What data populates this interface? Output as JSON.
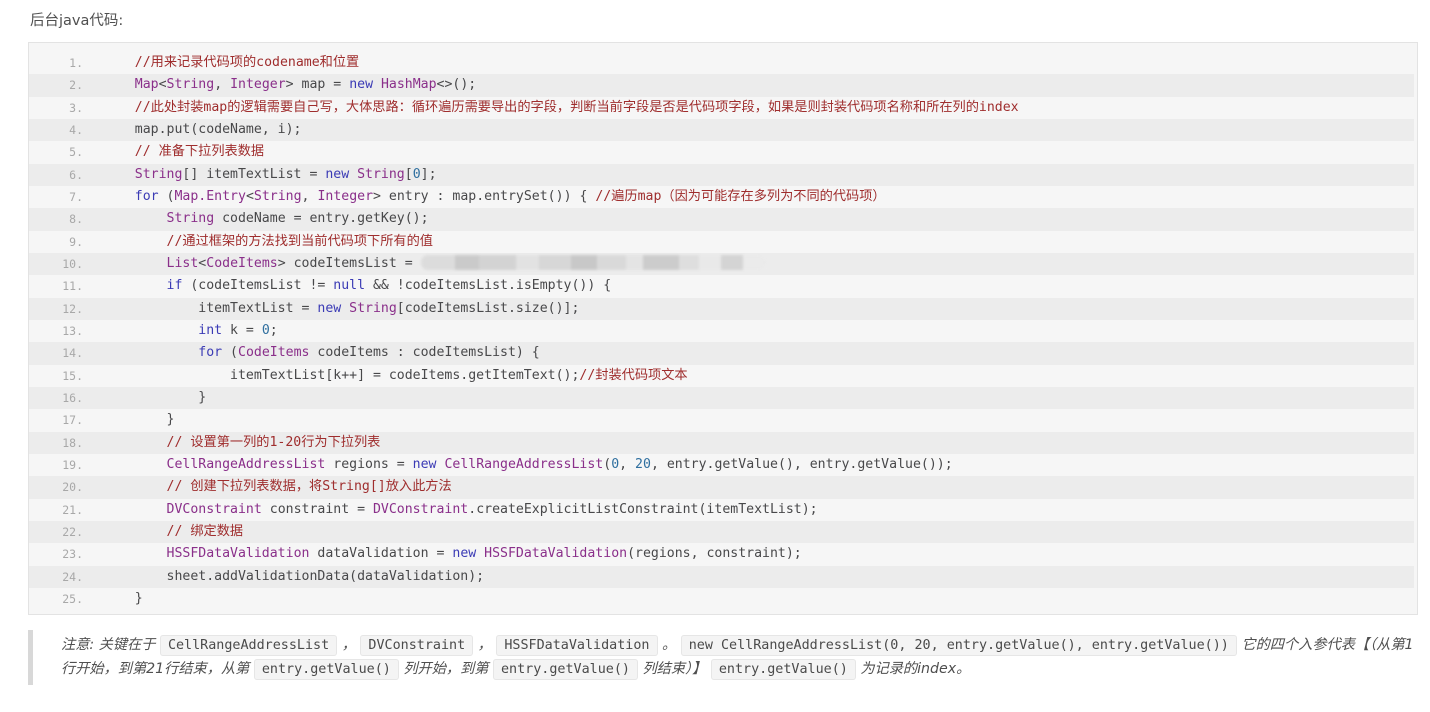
{
  "intro": {
    "text": "后台java代码:"
  },
  "code": {
    "language": "java",
    "lines": [
      {
        "n": "1.",
        "indent": 1,
        "tokens": [
          {
            "t": "cm",
            "s": "//用来记录代码项的codename和位置"
          }
        ]
      },
      {
        "n": "2.",
        "indent": 1,
        "tokens": [
          {
            "t": "ty",
            "s": "Map"
          },
          {
            "t": "pl",
            "s": "<"
          },
          {
            "t": "ty",
            "s": "String"
          },
          {
            "t": "pl",
            "s": ", "
          },
          {
            "t": "ty",
            "s": "Integer"
          },
          {
            "t": "pl",
            "s": "> map = "
          },
          {
            "t": "kw",
            "s": "new"
          },
          {
            "t": "pl",
            "s": " "
          },
          {
            "t": "ty",
            "s": "HashMap"
          },
          {
            "t": "pl",
            "s": "<>();"
          }
        ]
      },
      {
        "n": "3.",
        "indent": 1,
        "tokens": [
          {
            "t": "cm",
            "s": "//此处封装map的逻辑需要自己写，大体思路：循环遍历需要导出的字段，判断当前字段是否是代码项字段，如果是则封装代码项名称和所在列的index"
          }
        ]
      },
      {
        "n": "4.",
        "indent": 1,
        "tokens": [
          {
            "t": "pl",
            "s": "map.put(codeName, i);"
          }
        ]
      },
      {
        "n": "5.",
        "indent": 1,
        "tokens": [
          {
            "t": "cm",
            "s": "// 准备下拉列表数据"
          }
        ]
      },
      {
        "n": "6.",
        "indent": 1,
        "tokens": [
          {
            "t": "ty",
            "s": "String"
          },
          {
            "t": "pl",
            "s": "[] itemTextList = "
          },
          {
            "t": "kw",
            "s": "new"
          },
          {
            "t": "pl",
            "s": " "
          },
          {
            "t": "ty",
            "s": "String"
          },
          {
            "t": "pl",
            "s": "["
          },
          {
            "t": "nu",
            "s": "0"
          },
          {
            "t": "pl",
            "s": "];"
          }
        ]
      },
      {
        "n": "7.",
        "indent": 1,
        "tokens": [
          {
            "t": "kw",
            "s": "for"
          },
          {
            "t": "pl",
            "s": " ("
          },
          {
            "t": "ty",
            "s": "Map.Entry"
          },
          {
            "t": "pl",
            "s": "<"
          },
          {
            "t": "ty",
            "s": "String"
          },
          {
            "t": "pl",
            "s": ", "
          },
          {
            "t": "ty",
            "s": "Integer"
          },
          {
            "t": "pl",
            "s": "> entry : map.entrySet()) { "
          },
          {
            "t": "cm",
            "s": "//遍历map（因为可能存在多列为不同的代码项）"
          }
        ]
      },
      {
        "n": "8.",
        "indent": 2,
        "tokens": [
          {
            "t": "ty",
            "s": "String"
          },
          {
            "t": "pl",
            "s": " codeName = entry.getKey();"
          }
        ]
      },
      {
        "n": "9.",
        "indent": 2,
        "tokens": [
          {
            "t": "cm",
            "s": "//通过框架的方法找到当前代码项下所有的值"
          }
        ]
      },
      {
        "n": "10.",
        "indent": 2,
        "tokens": [
          {
            "t": "ty",
            "s": "List"
          },
          {
            "t": "pl",
            "s": "<"
          },
          {
            "t": "ty",
            "s": "CodeItems"
          },
          {
            "t": "pl",
            "s": "> codeItemsList = "
          },
          {
            "t": "redacted",
            "s": ""
          }
        ]
      },
      {
        "n": "11.",
        "indent": 2,
        "tokens": [
          {
            "t": "kw",
            "s": "if"
          },
          {
            "t": "pl",
            "s": " (codeItemsList != "
          },
          {
            "t": "kw",
            "s": "null"
          },
          {
            "t": "pl",
            "s": " && !codeItemsList.isEmpty()) {"
          }
        ]
      },
      {
        "n": "12.",
        "indent": 3,
        "tokens": [
          {
            "t": "pl",
            "s": "itemTextList = "
          },
          {
            "t": "kw",
            "s": "new"
          },
          {
            "t": "pl",
            "s": " "
          },
          {
            "t": "ty",
            "s": "String"
          },
          {
            "t": "pl",
            "s": "[codeItemsList.size()];"
          }
        ]
      },
      {
        "n": "13.",
        "indent": 3,
        "tokens": [
          {
            "t": "kw",
            "s": "int"
          },
          {
            "t": "pl",
            "s": " k = "
          },
          {
            "t": "nu",
            "s": "0"
          },
          {
            "t": "pl",
            "s": ";"
          }
        ]
      },
      {
        "n": "14.",
        "indent": 3,
        "tokens": [
          {
            "t": "kw",
            "s": "for"
          },
          {
            "t": "pl",
            "s": " ("
          },
          {
            "t": "ty",
            "s": "CodeItems"
          },
          {
            "t": "pl",
            "s": " codeItems : codeItemsList) {"
          }
        ]
      },
      {
        "n": "15.",
        "indent": 4,
        "tokens": [
          {
            "t": "pl",
            "s": "itemTextList[k++] = codeItems.getItemText();"
          },
          {
            "t": "cm",
            "s": "//封装代码项文本"
          }
        ]
      },
      {
        "n": "16.",
        "indent": 3,
        "tokens": [
          {
            "t": "pl",
            "s": "}"
          }
        ]
      },
      {
        "n": "17.",
        "indent": 2,
        "tokens": [
          {
            "t": "pl",
            "s": "}"
          }
        ]
      },
      {
        "n": "18.",
        "indent": 2,
        "tokens": [
          {
            "t": "cm",
            "s": "// 设置第一列的1-20行为下拉列表"
          }
        ]
      },
      {
        "n": "19.",
        "indent": 2,
        "tokens": [
          {
            "t": "ty",
            "s": "CellRangeAddressList"
          },
          {
            "t": "pl",
            "s": " regions = "
          },
          {
            "t": "kw",
            "s": "new"
          },
          {
            "t": "pl",
            "s": " "
          },
          {
            "t": "ty",
            "s": "CellRangeAddressList"
          },
          {
            "t": "pl",
            "s": "("
          },
          {
            "t": "nu",
            "s": "0"
          },
          {
            "t": "pl",
            "s": ", "
          },
          {
            "t": "nu",
            "s": "20"
          },
          {
            "t": "pl",
            "s": ", entry.getValue(), entry.getValue());"
          }
        ]
      },
      {
        "n": "20.",
        "indent": 2,
        "tokens": [
          {
            "t": "cm",
            "s": "// 创建下拉列表数据，将String[]放入此方法"
          }
        ]
      },
      {
        "n": "21.",
        "indent": 2,
        "tokens": [
          {
            "t": "ty",
            "s": "DVConstraint"
          },
          {
            "t": "pl",
            "s": " constraint = "
          },
          {
            "t": "ty",
            "s": "DVConstraint"
          },
          {
            "t": "pl",
            "s": ".createExplicitListConstraint(itemTextList);"
          }
        ]
      },
      {
        "n": "22.",
        "indent": 2,
        "tokens": [
          {
            "t": "cm",
            "s": "// 绑定数据"
          }
        ]
      },
      {
        "n": "23.",
        "indent": 2,
        "tokens": [
          {
            "t": "ty",
            "s": "HSSFDataValidation"
          },
          {
            "t": "pl",
            "s": " dataValidation = "
          },
          {
            "t": "kw",
            "s": "new"
          },
          {
            "t": "pl",
            "s": " "
          },
          {
            "t": "ty",
            "s": "HSSFDataValidation"
          },
          {
            "t": "pl",
            "s": "(regions, constraint);"
          }
        ]
      },
      {
        "n": "24.",
        "indent": 2,
        "tokens": [
          {
            "t": "pl",
            "s": "sheet.addValidationData(dataValidation);"
          }
        ]
      },
      {
        "n": "25.",
        "indent": 1,
        "tokens": [
          {
            "t": "pl",
            "s": "}"
          }
        ]
      }
    ]
  },
  "note": {
    "parts": [
      {
        "kind": "text",
        "s": "注意: 关键在于 "
      },
      {
        "kind": "code",
        "s": "CellRangeAddressList"
      },
      {
        "kind": "text",
        "s": " ， "
      },
      {
        "kind": "code",
        "s": "DVConstraint"
      },
      {
        "kind": "text",
        "s": " ， "
      },
      {
        "kind": "code",
        "s": "HSSFDataValidation"
      },
      {
        "kind": "text",
        "s": " 。 "
      },
      {
        "kind": "code",
        "s": "new CellRangeAddressList(0, 20, entry.getValue(), entry.getValue())"
      },
      {
        "kind": "text",
        "s": " 它的四个入参代表【（从第1行开始，到第21行结束，从第 "
      },
      {
        "kind": "code",
        "s": "entry.getValue()"
      },
      {
        "kind": "text",
        "s": " 列开始，到第 "
      },
      {
        "kind": "code",
        "s": "entry.getValue()"
      },
      {
        "kind": "text",
        "s": " 列结束）】 "
      },
      {
        "kind": "code",
        "s": "entry.getValue()"
      },
      {
        "kind": "text",
        "s": " 为记录的index。"
      }
    ]
  },
  "colors": {
    "comment": "#9f2d2d",
    "type": "#8a2f8a",
    "keyword": "#3b3bb5",
    "number": "#2f6f9f",
    "plain": "#48484a",
    "line_number": "#a8a8a8",
    "code_bg": "#f6f6f6",
    "code_bg_alt": "#ececec",
    "note_border": "#d8d8d8"
  }
}
